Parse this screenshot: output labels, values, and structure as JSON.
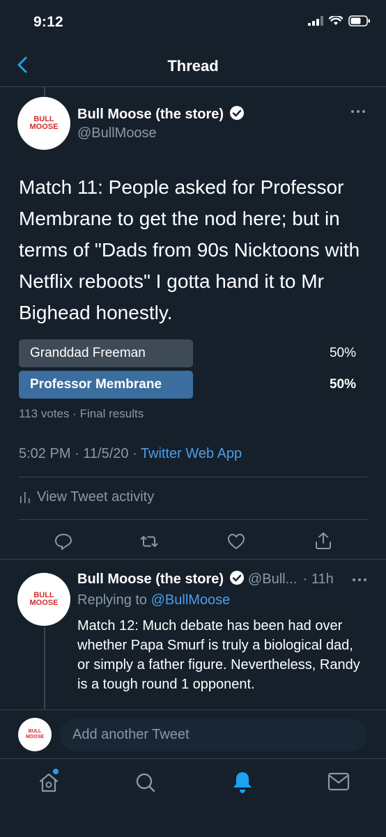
{
  "status": {
    "time": "9:12"
  },
  "nav": {
    "title": "Thread"
  },
  "main_tweet": {
    "author_name": "Bull Moose (the store)",
    "handle": "@BullMoose",
    "avatar_text": "BULL MOOSE",
    "text": "Match 11: People asked for Professor Membrane to get the nod here; but in terms of \"Dads from 90s Nicktoons with Netflix reboots\" I gotta hand it to Mr Bighead honestly.",
    "poll": {
      "options": [
        {
          "label": "Granddad Freeman",
          "percent": "50%",
          "fraction": 0.5,
          "winner": false
        },
        {
          "label": "Professor Membrane",
          "percent": "50%",
          "fraction": 0.5,
          "winner": true
        }
      ],
      "summary": "113 votes · Final results"
    },
    "meta_time": "5:02 PM · 11/5/20 · ",
    "meta_source": "Twitter Web App",
    "activity": "View Tweet activity"
  },
  "reply_tweet": {
    "author_name": "Bull Moose (the store)",
    "handle_truncated": "@Bull...",
    "age": "· 11h",
    "replying_prefix": "Replying to ",
    "replying_to": "@BullMoose",
    "avatar_text": "BULL MOOSE",
    "text": "Match 12: Much debate has been had over whether Papa Smurf is truly a biological dad, or simply a father figure. Nevertheless, Randy is a tough round 1 opponent."
  },
  "compose": {
    "placeholder": "Add another Tweet",
    "avatar_text": "BULL MOOSE"
  },
  "colors": {
    "background": "#15202b",
    "accent": "#1da1f2",
    "poll_winner": "#3b6e9e",
    "poll_other": "#3e4a56"
  },
  "tabbar": {
    "icons": [
      "home-icon",
      "search-icon",
      "notifications-icon",
      "messages-icon"
    ],
    "active": "notifications-icon"
  }
}
